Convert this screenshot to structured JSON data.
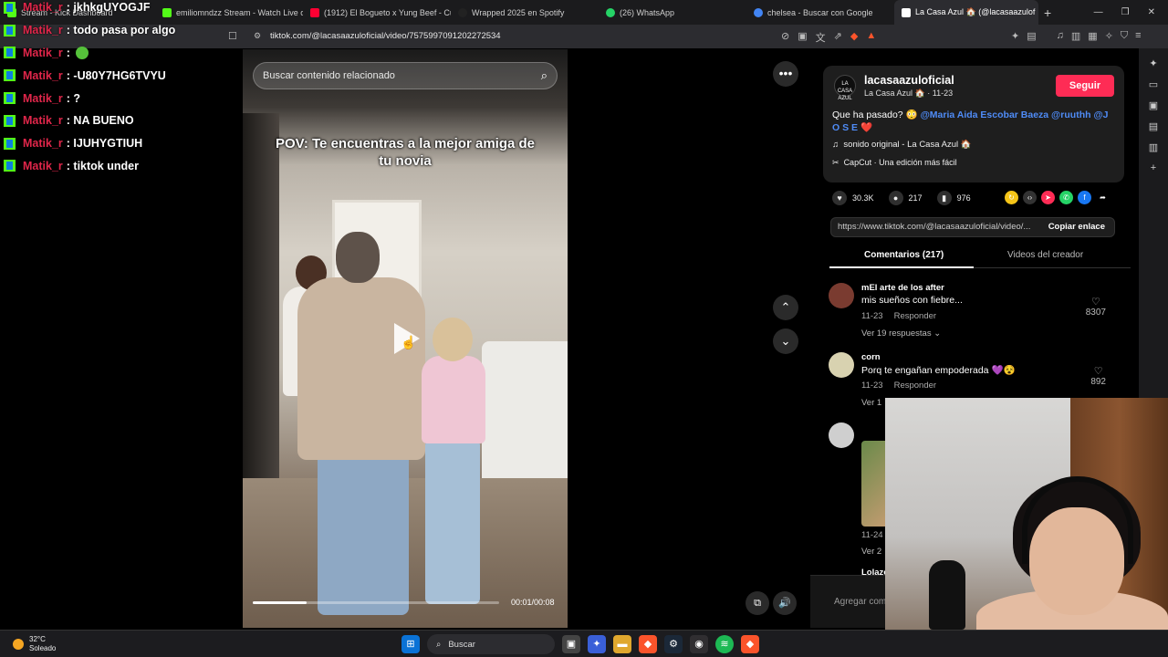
{
  "browser": {
    "tabs": [
      {
        "title": "Stream - Kick Dashboard",
        "fav_color": "#53fc18"
      },
      {
        "title": "emiliomndzz Stream - Watch Live on",
        "fav_color": "#53fc18"
      },
      {
        "title": "(1912) El Bogueto x Yung Beef - Cua",
        "fav_color": "#ff0033"
      },
      {
        "title": "Wrapped 2025 en Spotify",
        "fav_color": "#1db954"
      },
      {
        "title": "(26) WhatsApp",
        "fav_color": "#25d366"
      },
      {
        "title": "chelsea - Buscar con Google",
        "fav_color": "#4285f4"
      },
      {
        "title": "La Casa Azul 🏠 (@lacasaazulof",
        "fav_color": "#ffffff"
      }
    ],
    "close_glyph": "✕",
    "new_tab_glyph": "+",
    "url": "tiktok.com/@lacasaazuloficial/video/7575997091202272534"
  },
  "chat": [
    {
      "user": "Matik_r",
      "msg": ": jkhkgUYOGJF"
    },
    {
      "user": "Matik_r",
      "msg": ": todo pasa por algo"
    },
    {
      "user": "Matik_r",
      "msg": ":",
      "emote": "frog"
    },
    {
      "user": "Matik_r",
      "msg": ": -U80Y7HG6TVYU"
    },
    {
      "user": "Matik_r",
      "msg": ": ?"
    },
    {
      "user": "Matik_r",
      "msg": ": NA BUENO"
    },
    {
      "user": "Matik_r",
      "msg": ": IJUHYGTIUH"
    },
    {
      "user": "Matik_r",
      "msg": ": tiktok under"
    }
  ],
  "video": {
    "search_placeholder": "Buscar contenido relacionado",
    "caption": "POV: Te encuentras a la mejor amiga de tu novia",
    "time": "00:01/00:08",
    "progress": 0.22
  },
  "post": {
    "avatar_text": "LA CASA AZUL",
    "username": "lacasaazuloficial",
    "subline": "La Casa Azul 🏠 · 11-23",
    "follow_label": "Seguir",
    "desc_text": "Que ha pasado? 😳",
    "mentions": "@Maria Aida Escobar Baeza @ruuthh @J O S E",
    "desc_emoji": "❤️",
    "music": "sonido original - La Casa Azul 🏠",
    "capcut": "CapCut · Una edición más fácil",
    "likes": "30.3K",
    "comments": "217",
    "saves": "976",
    "link": "https://www.tiktok.com/@lacasaazuloficial/video/...",
    "copy_label": "Copiar enlace",
    "tab_comments": "Comentarios (217)",
    "tab_videos": "Videos del creador"
  },
  "comments": [
    {
      "name": "mEl arte de los after",
      "text": "mis sueños con fiebre...",
      "date": "11-23",
      "reply": "Responder",
      "likes": "8307",
      "replies": "Ver 19 respuestas ⌄"
    },
    {
      "name": "corn",
      "text": "Porq te engañan empoderada 💜😵",
      "date": "11-23",
      "reply": "Responder",
      "likes": "892",
      "replies": "Ver 1"
    },
    {
      "name": "",
      "text": "",
      "date": "11-24",
      "reply": "",
      "likes": "",
      "replies": "Ver 2"
    },
    {
      "name": "Lolazo",
      "text": "",
      "date": "",
      "reply": "",
      "likes": "",
      "replies": ""
    }
  ],
  "add_comment": "Agregar com",
  "taskbar": {
    "temp": "32°C",
    "weather": "Soleado",
    "search": "Buscar"
  },
  "icons": [
    "windows-icon",
    "search-icon",
    "kick-icon",
    "chrome-icon",
    "folder-icon",
    "brave-icon",
    "steam-icon",
    "obs-icon",
    "spotify-icon"
  ]
}
